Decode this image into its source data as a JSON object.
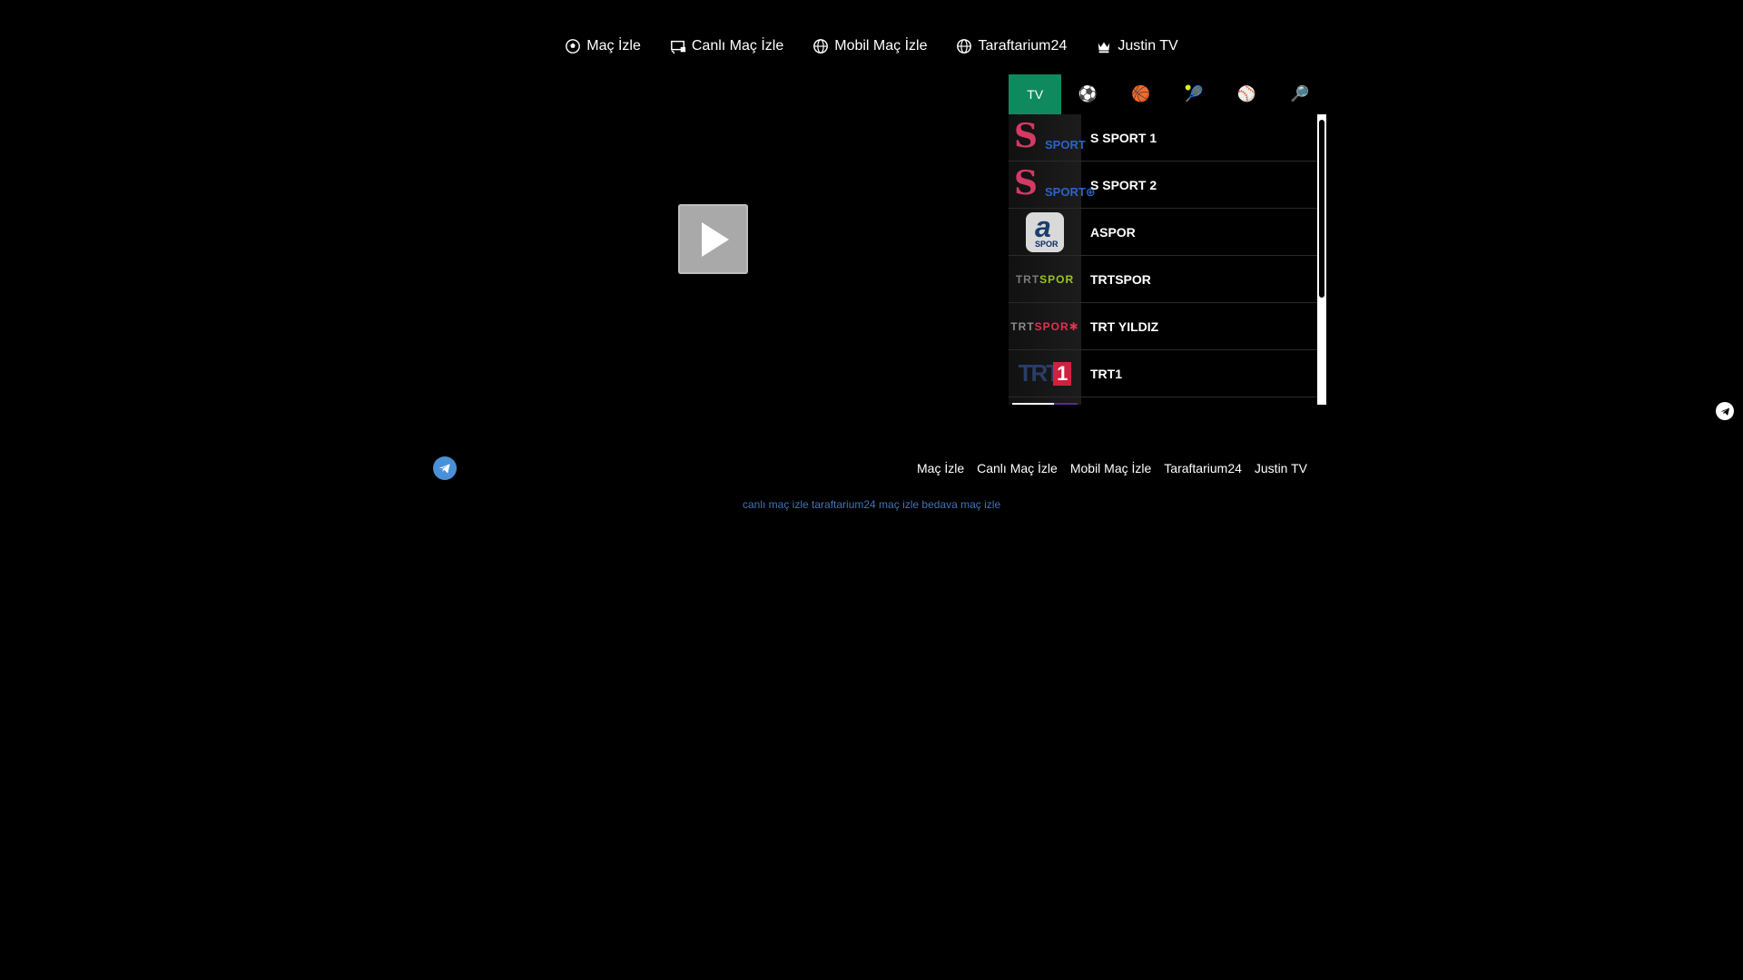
{
  "nav": {
    "items": [
      {
        "label": "Maç İzle",
        "icon": "soccer-ball-icon"
      },
      {
        "label": "Canlı Maç İzle",
        "icon": "cast-screen-icon"
      },
      {
        "label": "Mobil Maç İzle",
        "icon": "globe-icon"
      },
      {
        "label": "Taraftarium24",
        "icon": "globe-icon"
      },
      {
        "label": "Justin TV",
        "icon": "crown-icon"
      }
    ]
  },
  "player": {
    "play_icon": "play-icon"
  },
  "tabs": [
    {
      "label": "TV",
      "icon": null,
      "active": true
    },
    {
      "label": "⚽",
      "icon": "soccer-ball-icon"
    },
    {
      "label": "🏀",
      "icon": "basketball-icon"
    },
    {
      "label": "🎾",
      "icon": "tennis-icon"
    },
    {
      "label": "⚾",
      "icon": "baseball-icon"
    },
    {
      "label": "🔎",
      "icon": "search-icon"
    }
  ],
  "channels": [
    {
      "name": "S SPORT 1",
      "logo_text": "S",
      "logo_sub": "SPORT"
    },
    {
      "name": "S SPORT 2",
      "logo_text": "S",
      "logo_sub": "SPORT⊕"
    },
    {
      "name": "ASPOR",
      "logo_text": "a",
      "logo_sub": "SPOR"
    },
    {
      "name": "TRTSPOR",
      "logo_text": "SPOR"
    },
    {
      "name": "TRT YILDIZ",
      "logo_text": "SPOR✱"
    },
    {
      "name": "TRT1",
      "logo_text": "1"
    },
    {
      "name": "",
      "logo_text": ""
    }
  ],
  "footer": {
    "links": [
      "Maç İzle",
      "Canlı Maç İzle",
      "Mobil Maç İzle",
      "Taraftarium24",
      "Justin TV"
    ],
    "tags": "canlı maç izle taraftarium24 maç izle bedava maç izle"
  },
  "colors": {
    "accent": "#0f8a5f",
    "link_blue": "#3f74b7",
    "telegram": "#4a90d9"
  }
}
